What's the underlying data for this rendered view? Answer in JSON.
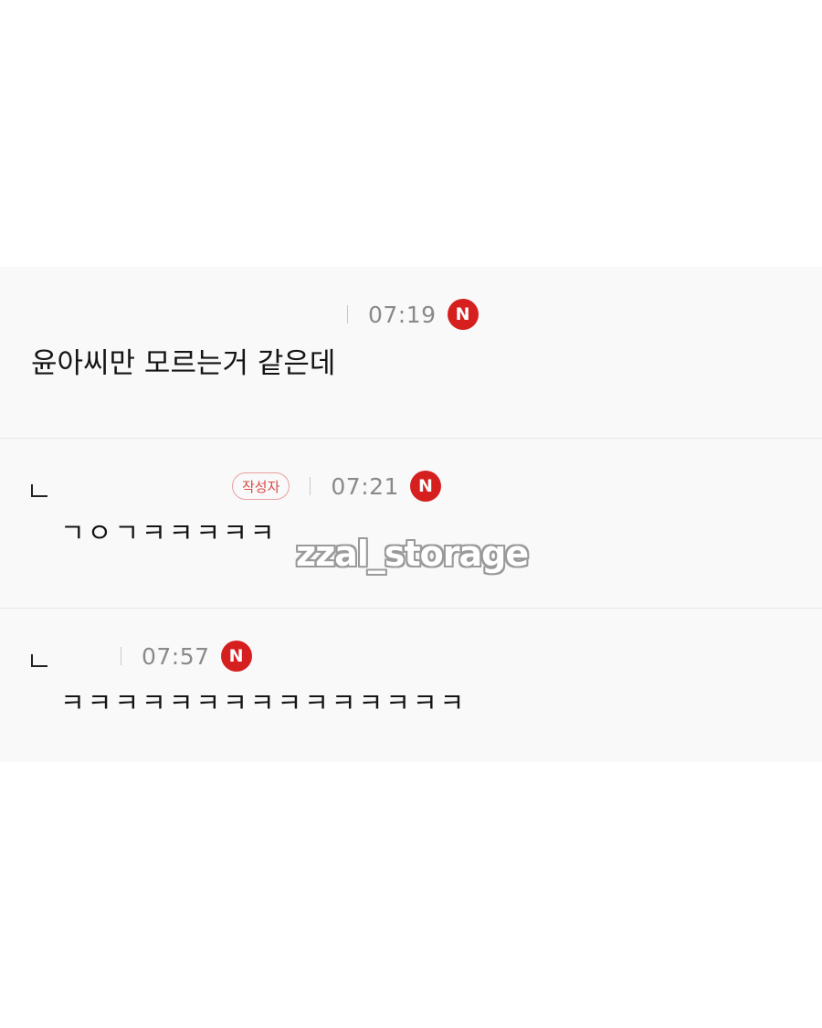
{
  "comments": [
    {
      "is_reply": false,
      "author_badge": null,
      "time": "07:19",
      "new_badge": "N",
      "text": "윤아씨만 모르는거 같은데"
    },
    {
      "is_reply": true,
      "author_badge": "작성자",
      "time": "07:21",
      "new_badge": "N",
      "text": "ㄱㅇㄱㅋㅋㅋㅋㅋ"
    },
    {
      "is_reply": true,
      "author_badge": null,
      "time": "07:57",
      "new_badge": "N",
      "text": "ㅋㅋㅋㅋㅋㅋㅋㅋㅋㅋㅋㅋㅋㅋㅋ"
    }
  ],
  "watermark": "zzal_storage",
  "colors": {
    "new_badge": "#d61f1f",
    "author_badge": "#d94a4a",
    "time": "#8a8a8a",
    "comment_bg": "#f9f9f9"
  },
  "icons": {
    "reply": "reply-arrow-icon",
    "new": "new-badge-icon"
  }
}
